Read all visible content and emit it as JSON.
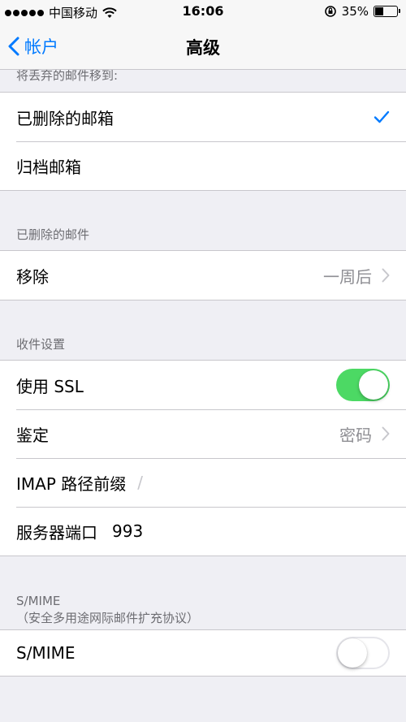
{
  "status_bar": {
    "carrier": "中国移动",
    "time": "16:06",
    "battery": "35%",
    "battery_level": 0.35
  },
  "nav": {
    "back_label": "帐户",
    "title": "高级"
  },
  "sections": {
    "move_discarded": {
      "header": "将丢弃的邮件移到:",
      "items": [
        "已删除的邮箱",
        "归档邮箱"
      ],
      "selected_index": 0
    },
    "deleted_mail": {
      "header": "已删除的邮件",
      "remove_label": "移除",
      "remove_value": "一周后"
    },
    "incoming": {
      "header": "收件设置",
      "ssl_label": "使用 SSL",
      "ssl_on": true,
      "auth_label": "鉴定",
      "auth_value": "密码",
      "imap_label": "IMAP 路径前缀",
      "imap_value": "/",
      "port_label": "服务器端口",
      "port_value": "993"
    },
    "smime": {
      "header": "S/MIME",
      "subheader": "（安全多用途网际邮件扩充协议）",
      "label": "S/MIME",
      "on": false
    }
  },
  "colors": {
    "accent": "#007aff",
    "toggle_on": "#4cd964",
    "background": "#efeff4"
  }
}
